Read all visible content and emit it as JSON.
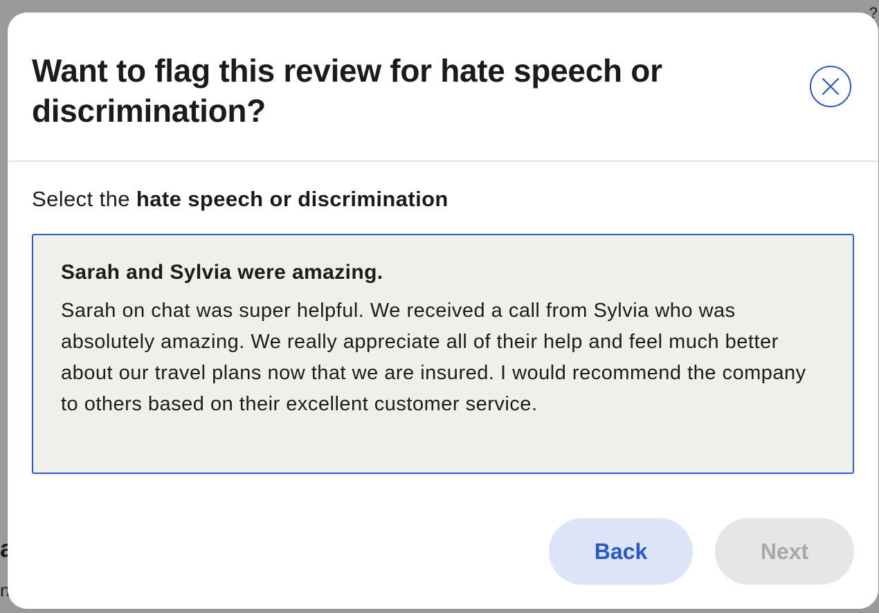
{
  "background": {
    "fragment_a": "a",
    "fragment_n": "n",
    "fragment_q": "?"
  },
  "modal": {
    "title": "Want to flag this review for hate speech or discrimination?",
    "close_icon": "close-icon",
    "instruction_prefix": "Select the ",
    "instruction_emphasis": "hate speech or discrimination",
    "review": {
      "title": "Sarah and Sylvia were amazing.",
      "body": "Sarah on chat was super helpful. We received a call from Sylvia who was absolutely amazing. We really appreciate all of their help and feel much better about our travel plans now that we are insured. I would recommend the company to others based on their excellent customer service."
    },
    "buttons": {
      "back_label": "Back",
      "next_label": "Next"
    }
  },
  "colors": {
    "accent": "#2a57c9",
    "back_button_bg": "#dce5f8",
    "next_button_bg": "#e6e6e6",
    "review_bg": "#f0efea"
  }
}
